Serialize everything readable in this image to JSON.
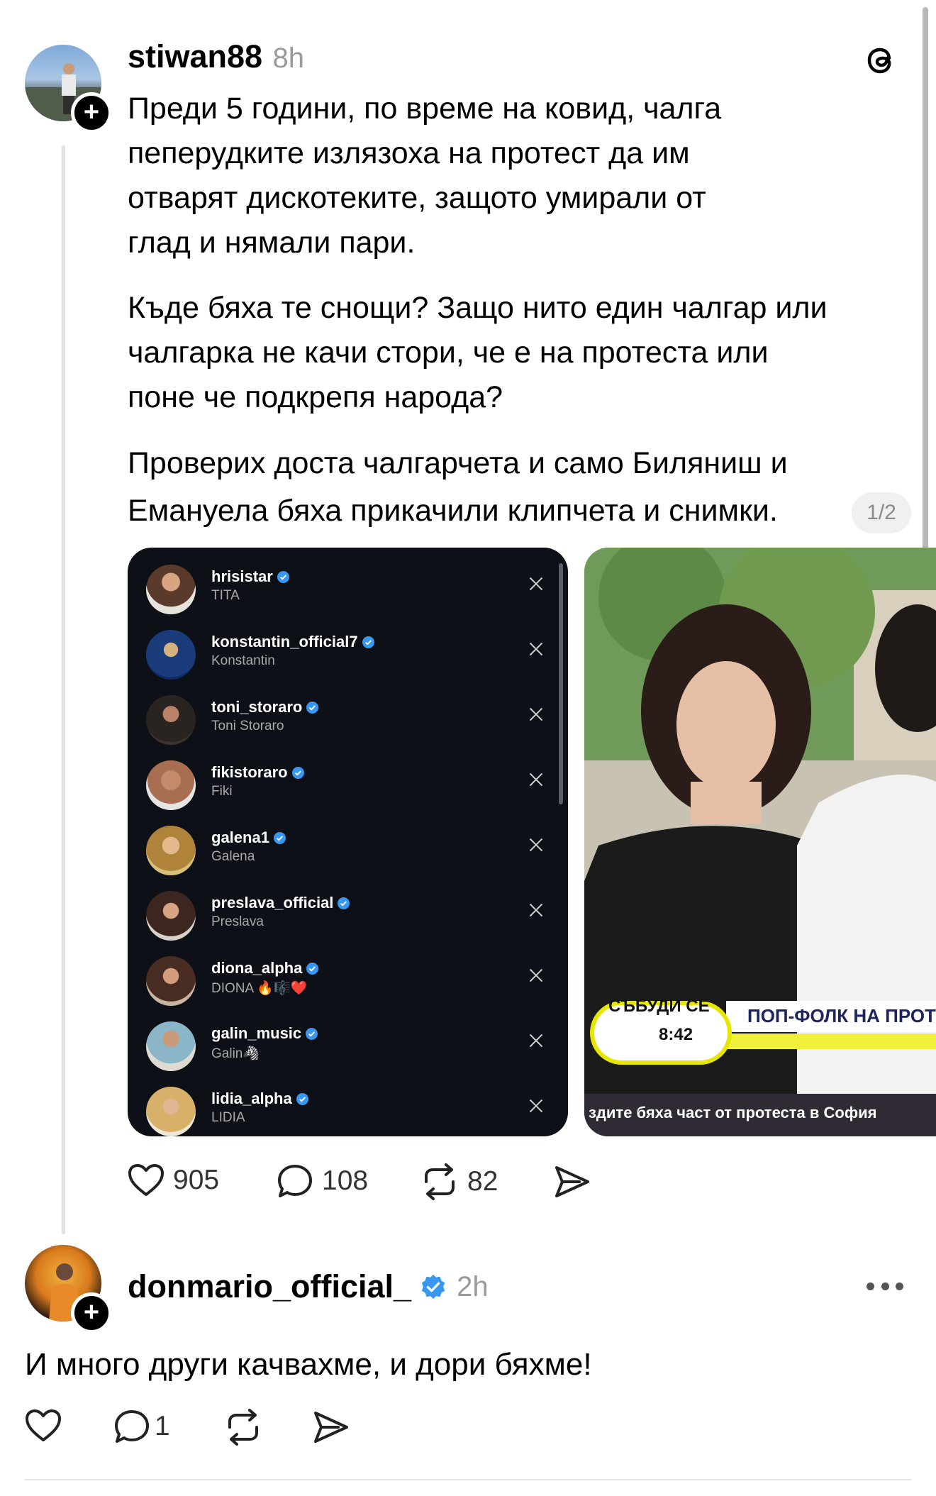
{
  "post": {
    "username": "stiwan88",
    "time": "8h",
    "paragraphs": [
      "Преди 5 години, по време на ковид, чалга",
      "пеперудките излязоха на протест да им",
      "отварят дискотеките, защото умирали от",
      "глад и нямали пари.",
      "Къде бяха те снощи? Защо нито един чалгар или",
      "чалгарка не качи стори, че е на протеста или",
      "поне че подкрепя народа?",
      "Проверих доста чалгарчета и само Биляниш и",
      "Емануела бяха прикачили клипчета и снимки."
    ],
    "page_indicator": "1/2",
    "actions": {
      "likes": "905",
      "comments": "108",
      "reposts": "82"
    }
  },
  "carousel": {
    "follow_list": [
      {
        "user": "hrisistar",
        "name": "TITA"
      },
      {
        "user": "konstantin_official7",
        "name": "Konstantin"
      },
      {
        "user": "toni_storaro",
        "name": "Toni Storaro"
      },
      {
        "user": "fikistoraro",
        "name": "Fiki"
      },
      {
        "user": "galena1",
        "name": "Galena"
      },
      {
        "user": "preslava_official",
        "name": "Preslava"
      },
      {
        "user": "diona_alpha",
        "name": "DIONA 🔥🎼❤️"
      },
      {
        "user": "galin_music",
        "name": "Galin🦓"
      },
      {
        "user": "lidia_alpha",
        "name": "LIDIA"
      }
    ],
    "tv": {
      "logo": "СЪБУДИ СЕ",
      "time": "8:42",
      "strip": "ПОП-ФОЛК НА ПРОТ",
      "caption": "здите бяха част от протеста в София"
    }
  },
  "reply": {
    "username": "donmario_official_",
    "time": "2h",
    "text": "И много други качвахме, и дори бяхме!",
    "actions": {
      "comments": "1"
    }
  },
  "colors": {
    "verified": "#3897f0",
    "muted": "#9a9a9a",
    "dark_slide": "#0d1117"
  }
}
